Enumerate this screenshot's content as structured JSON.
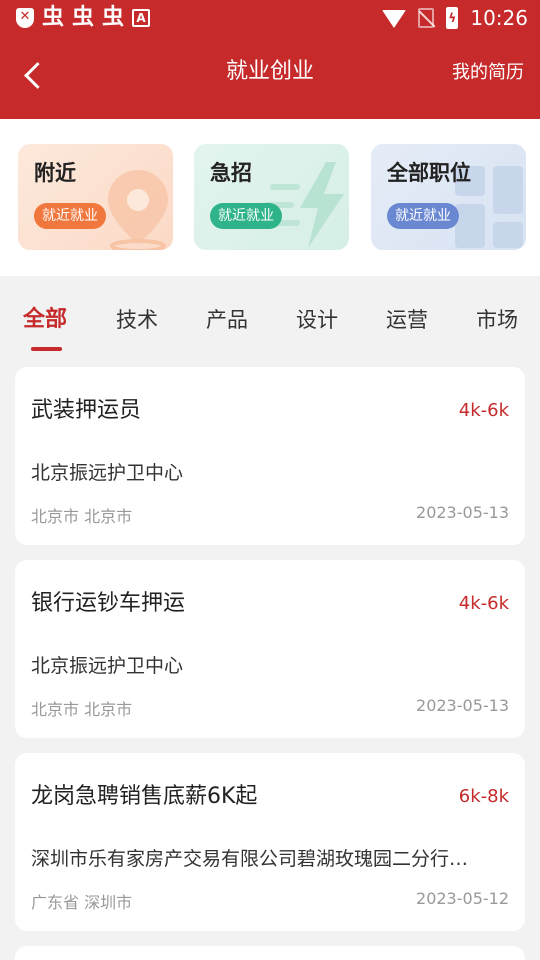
{
  "status_bar": {
    "time": "10:26",
    "left_icons": [
      "shield-icon",
      "bug-icon",
      "bug-icon",
      "bug-icon",
      "accessibility-a-icon"
    ],
    "right_icons": [
      "wifi-icon",
      "no-sim-icon",
      "battery-charging-icon"
    ]
  },
  "nav": {
    "title": "就业创业",
    "right_label": "我的简历",
    "back_icon": "chevron-left-icon"
  },
  "categories": [
    {
      "title": "附近",
      "tag": "就近就业",
      "icon": "location-pin-icon",
      "color": "#f0773d"
    },
    {
      "title": "急招",
      "tag": "就近就业",
      "icon": "lightning-icon",
      "color": "#2fb38a"
    },
    {
      "title": "全部职位",
      "tag": "就近就业",
      "icon": "grid-icon",
      "color": "#6a88d2"
    }
  ],
  "tabs": [
    {
      "label": "全部",
      "active": true
    },
    {
      "label": "技术",
      "active": false
    },
    {
      "label": "产品",
      "active": false
    },
    {
      "label": "设计",
      "active": false
    },
    {
      "label": "运营",
      "active": false
    },
    {
      "label": "市场",
      "active": false
    }
  ],
  "jobs": [
    {
      "title": "武装押运员",
      "salary": "4k-6k",
      "company": "北京振远护卫中心",
      "location": "北京市 北京市",
      "date": "2023-05-13"
    },
    {
      "title": "银行运钞车押运",
      "salary": "4k-6k",
      "company": "北京振远护卫中心",
      "location": "北京市 北京市",
      "date": "2023-05-13"
    },
    {
      "title": "龙岗急聘销售底薪6K起",
      "salary": "6k-8k",
      "company": "深圳市乐有家房产交易有限公司碧湖玫瑰园二分行…",
      "location": "广东省 深圳市",
      "date": "2023-05-12"
    }
  ],
  "colors": {
    "primary": "#c62a2b",
    "background": "#f2f2f2"
  }
}
